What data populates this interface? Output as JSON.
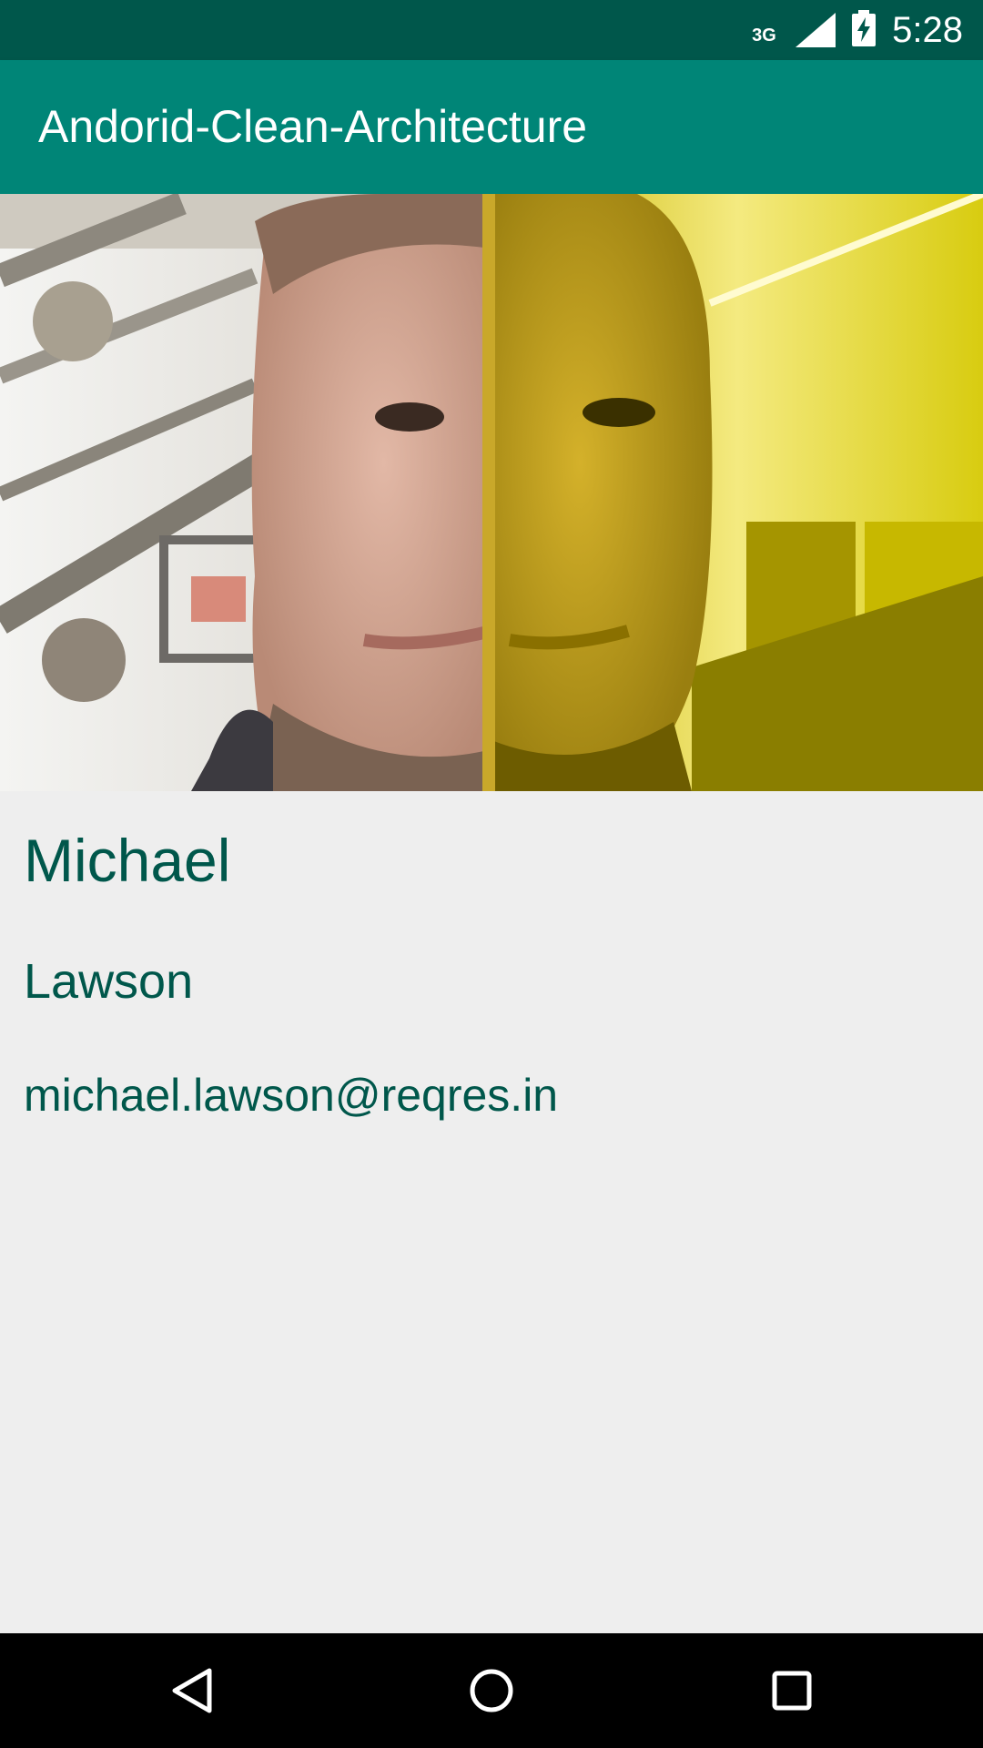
{
  "status_bar": {
    "network_label": "3G",
    "time": "5:28",
    "icons": [
      "signal-icon",
      "battery-charging-icon"
    ]
  },
  "app_bar": {
    "title": "Andorid-Clean-Architecture"
  },
  "photo": {
    "description_icon": "user-photo"
  },
  "user": {
    "first_name": "Michael",
    "last_name": "Lawson",
    "email": "michael.lawson@reqres.in"
  },
  "nav_bar": {
    "icons": [
      "back-icon",
      "home-icon",
      "recents-icon"
    ]
  },
  "colors": {
    "status_bar": "#00574b",
    "app_bar": "#008577",
    "text": "#00574b",
    "background": "#eeeeee"
  }
}
